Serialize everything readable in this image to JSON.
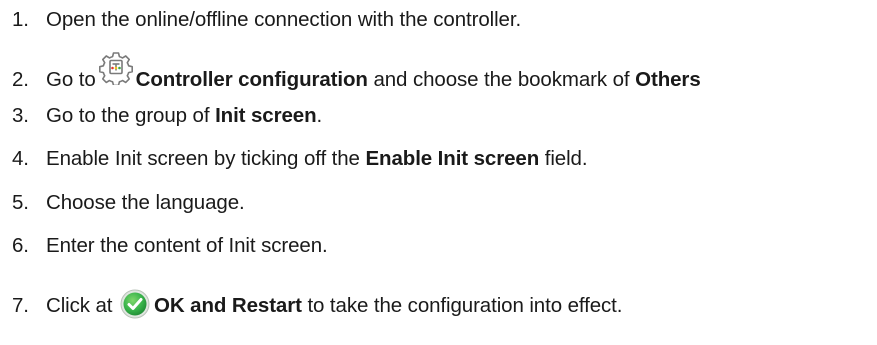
{
  "steps": [
    {
      "number": "1.",
      "text": "Open the online/offline connection with the controller."
    },
    {
      "number": "2.",
      "pre": "Go to",
      "icon": "controller-configuration-gear-icon",
      "bold1": "Controller configuration",
      "mid": " and choose the bookmark of ",
      "bold2": "Others"
    },
    {
      "number": "3.",
      "pre": "Go to the group of ",
      "bold1": "Init screen",
      "post": "."
    },
    {
      "number": "4.",
      "pre": "Enable Init screen by ticking off the ",
      "bold1": "Enable Init screen",
      "post": " field."
    },
    {
      "number": "5.",
      "text": "Choose the language."
    },
    {
      "number": "6.",
      "text": "Enter the content of Init screen."
    },
    {
      "number": "7.",
      "pre": "Click at ",
      "icon": "green-checkmark-icon",
      "bold1": "OK and Restart",
      "post": " to take the configuration into effect."
    }
  ],
  "colors": {
    "text": "#1a1a1a",
    "check_green": "#37b34a",
    "gear_gray": "#7a7a7a",
    "gear_accent_red": "#e03a2f",
    "gear_accent_yellow": "#f0c419",
    "gear_accent_green": "#3aa845"
  }
}
